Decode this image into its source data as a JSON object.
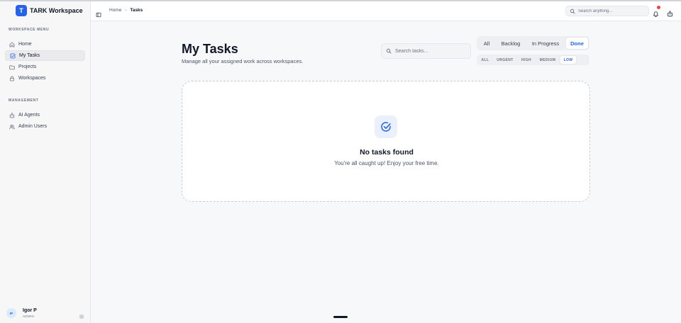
{
  "app": {
    "name": "TARK Workspace",
    "logo_letter": "T"
  },
  "sidebar": {
    "workspace_menu_label": "WORKSPACE MENU",
    "workspace_items": [
      {
        "label": "Home",
        "icon": "home-icon",
        "active": false
      },
      {
        "label": "My Tasks",
        "icon": "checkbox-icon",
        "active": true
      },
      {
        "label": "Projects",
        "icon": "folder-icon",
        "active": false
      },
      {
        "label": "Workspaces",
        "icon": "lock-icon",
        "active": false
      }
    ],
    "management_label": "MANAGEMENT",
    "management_items": [
      {
        "label": "AI Agents",
        "icon": "bot-icon",
        "active": false
      },
      {
        "label": "Admin Users",
        "icon": "users-icon",
        "active": false
      }
    ],
    "user": {
      "initials": "IP",
      "name": "Igor P",
      "role": "ADMIN"
    }
  },
  "header": {
    "breadcrumb": {
      "home": "Home",
      "separator": "›",
      "current": "Tasks"
    },
    "search": {
      "placeholder": "Search anything..."
    },
    "notification_dot_color": "#ef4444"
  },
  "main": {
    "title": "My Tasks",
    "subtitle": "Manage all your assigned work across workspaces.",
    "task_search": {
      "placeholder": "Search tasks..."
    },
    "status_tabs": [
      {
        "label": "All",
        "active": false
      },
      {
        "label": "Backlog",
        "active": false
      },
      {
        "label": "In Progress",
        "active": false
      },
      {
        "label": "Done",
        "active": true
      }
    ],
    "priority_tabs": [
      {
        "label": "ALL",
        "active": false
      },
      {
        "label": "URGENT",
        "active": false
      },
      {
        "label": "HIGH",
        "active": false
      },
      {
        "label": "MEDIUM",
        "active": false
      },
      {
        "label": "LOW",
        "active": true
      }
    ],
    "empty_state": {
      "icon": "check-circle-icon",
      "title": "No tasks found",
      "message": "You're all caught up! Enjoy your free time."
    }
  },
  "colors": {
    "accent": "#2563eb",
    "background": "#f7f8fa"
  }
}
